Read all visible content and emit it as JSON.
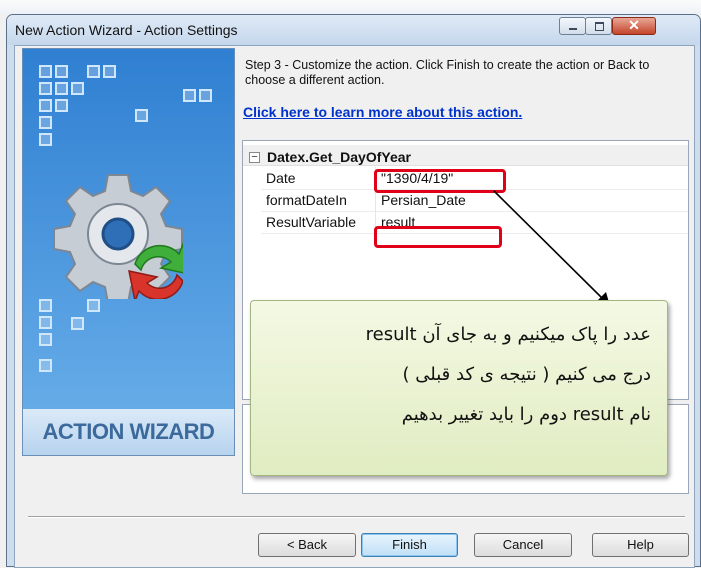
{
  "window": {
    "title": "New Action Wizard - Action Settings",
    "controls": {
      "minimize": "minimize-icon",
      "maximize": "maximize-icon",
      "close": "close-icon"
    }
  },
  "banner": {
    "label": "ACTION WIZARD",
    "icon": "gear-refresh-icon"
  },
  "step": {
    "instructions": "Step 3 - Customize the action.  Click Finish to create the action or Back to choose a different action.",
    "learn_more_link": "Click here to learn more about this action."
  },
  "properties": {
    "group": "Datex.Get_DayOfYear",
    "expander": "−",
    "rows": [
      {
        "name": "Date",
        "value": "\"1390/4/19\""
      },
      {
        "name": "formatDateIn",
        "value": "Persian_Date"
      },
      {
        "name": "ResultVariable",
        "value": "result"
      }
    ]
  },
  "callout": {
    "lines": [
      "عدد را پاک میکنیم و به جای آن result",
      "درج می کنیم ( نتیجه ی کد قبلی )",
      "نام result دوم را باید تغییر بدهیم"
    ]
  },
  "buttons": {
    "back": "< Back",
    "finish": "Finish",
    "cancel": "Cancel",
    "help": "Help"
  },
  "colors": {
    "highlight": "#e0001a",
    "link": "#0033cc",
    "callout_bg": "#e7f1cd",
    "banner_bg": "#3b8bdc"
  }
}
